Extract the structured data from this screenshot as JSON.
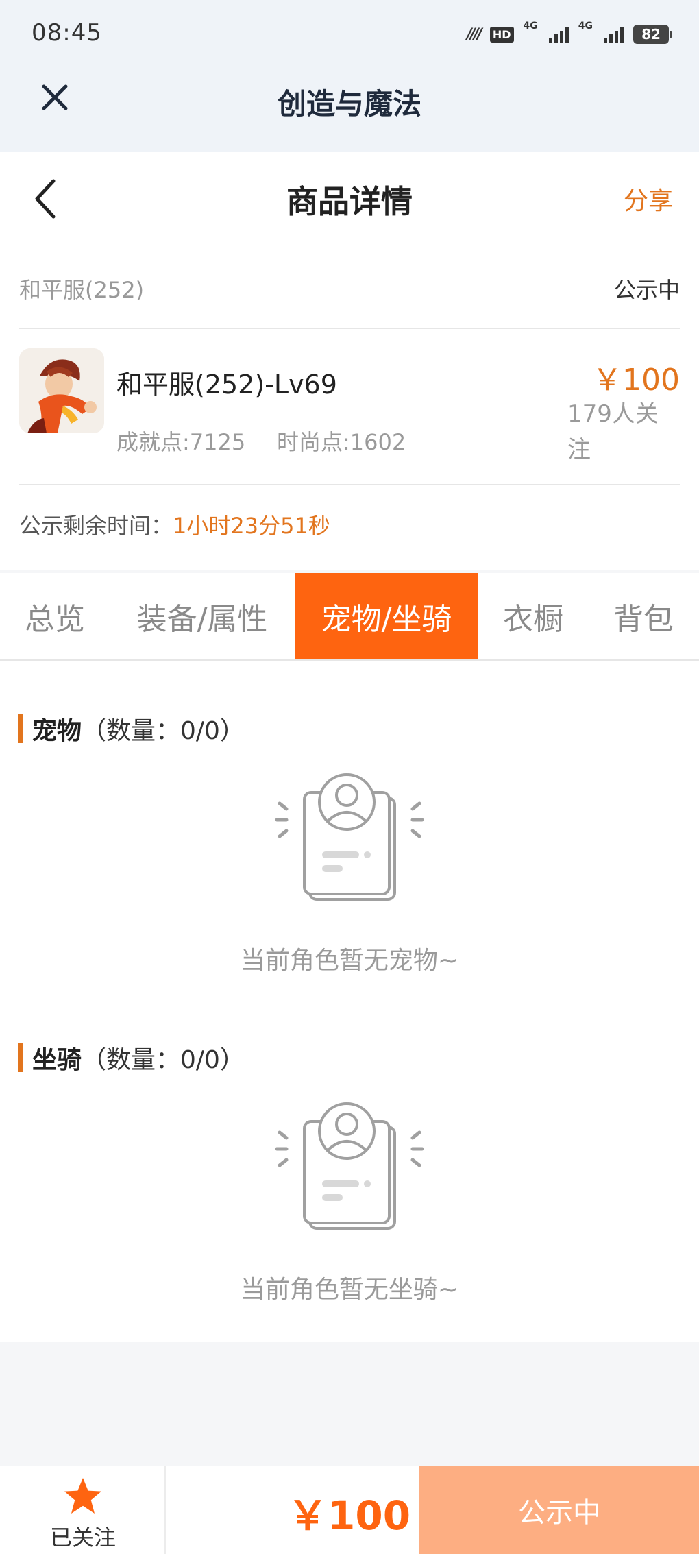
{
  "status_bar": {
    "time": "08:45",
    "hd_label": "HD",
    "net1_label": "4G",
    "net2_label": "4G",
    "battery": "82"
  },
  "app_bar": {
    "title": "创造与魔法",
    "close_icon": "close-icon"
  },
  "header": {
    "title": "商品详情",
    "share_label": "分享",
    "back_icon": "chevron-left-icon"
  },
  "listing": {
    "category": "和平服(252)",
    "status": "公示中",
    "item_title": "和平服(252)-Lv69",
    "achievement": "成就点:7125",
    "fashion": "时尚点:1602",
    "price": "￥100",
    "watchers": "179人关注",
    "countdown_label": "公示剩余时间：",
    "countdown_value": "1小时23分51秒"
  },
  "tabs": [
    {
      "label": "总览",
      "active": false
    },
    {
      "label": "装备/属性",
      "active": false
    },
    {
      "label": "宠物/坐骑",
      "active": true
    },
    {
      "label": "衣橱",
      "active": false
    },
    {
      "label": "背包",
      "active": false
    }
  ],
  "sections": {
    "pets": {
      "title": "宠物",
      "count": "（数量：0/0）",
      "empty_text": "当前角色暂无宠物~"
    },
    "mounts": {
      "title": "坐骑",
      "count": "（数量：0/0）",
      "empty_text": "当前角色暂无坐骑~"
    }
  },
  "bottom_bar": {
    "follow_label": "已关注",
    "price": "￥100",
    "status_button": "公示中"
  },
  "colors": {
    "accent": "#e2751e",
    "tab_active": "#fe6410",
    "status_button": "#fdae82"
  }
}
